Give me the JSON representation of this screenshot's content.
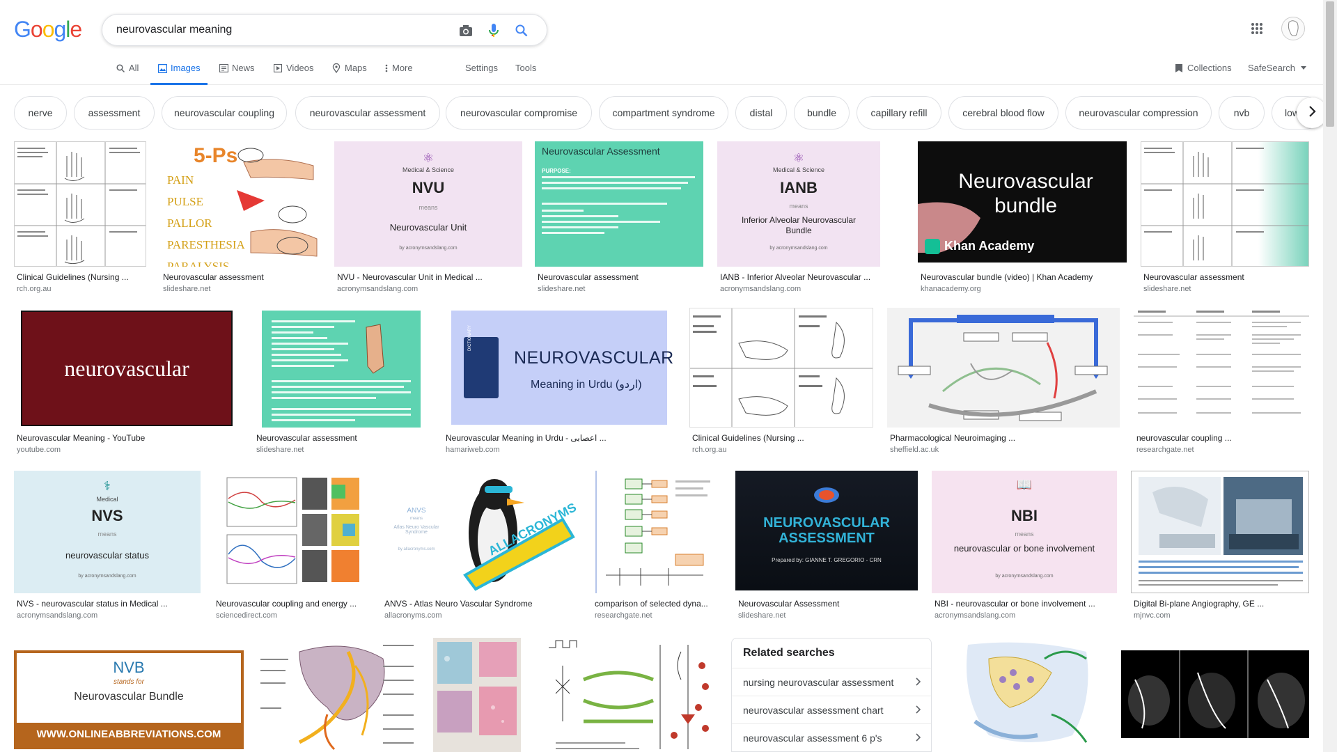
{
  "header": {
    "logo": [
      "G",
      "o",
      "o",
      "g",
      "l",
      "e"
    ],
    "query": "neurovascular meaning"
  },
  "tabs": [
    {
      "label": "All",
      "icon": "search-icon"
    },
    {
      "label": "Images",
      "icon": "image-icon"
    },
    {
      "label": "News",
      "icon": "news-icon"
    },
    {
      "label": "Videos",
      "icon": "video-icon"
    },
    {
      "label": "Maps",
      "icon": "map-pin-icon"
    },
    {
      "label": "More",
      "icon": "more-vert-icon"
    }
  ],
  "tools": {
    "settings": "Settings",
    "tools": "Tools",
    "collections": "Collections",
    "safesearch": "SafeSearch"
  },
  "chips": [
    "nerve",
    "assessment",
    "neurovascular coupling",
    "neurovascular assessment",
    "neurovascular compromise",
    "compartment syndrome",
    "distal",
    "bundle",
    "capillary refill",
    "cerebral blood flow",
    "neurovascular compression",
    "nvb",
    "low"
  ],
  "results": [
    {
      "title": "Clinical Guidelines (Nursing ...",
      "source": "rch.org.au"
    },
    {
      "title": "Neurovascular assessment",
      "source": "slideshare.net"
    },
    {
      "title": "NVU - Neurovascular Unit in Medical ...",
      "source": "acronymsandslang.com"
    },
    {
      "title": "Neurovascular assessment",
      "source": "slideshare.net"
    },
    {
      "title": "IANB - Inferior Alveolar Neurovascular ...",
      "source": "acronymsandslang.com"
    },
    {
      "title": "Neurovascular bundle (video) | Khan Academy",
      "source": "khanacademy.org"
    },
    {
      "title": "Neurovascular assessment",
      "source": "slideshare.net"
    },
    {
      "title": "Neurovascular Meaning - YouTube",
      "source": "youtube.com"
    },
    {
      "title": "Neurovascular assessment",
      "source": "slideshare.net"
    },
    {
      "title": "Neurovascular Meaning in Urdu - اعصابی ...",
      "source": "hamariweb.com"
    },
    {
      "title": "Clinical Guidelines (Nursing ...",
      "source": "rch.org.au"
    },
    {
      "title": "Pharmacological Neuroimaging ...",
      "source": "sheffield.ac.uk"
    },
    {
      "title": "neurovascular coupling ...",
      "source": "researchgate.net"
    },
    {
      "title": "NVS - neurovascular status in Medical ...",
      "source": "acronymsandslang.com"
    },
    {
      "title": "Neurovascular coupling and energy ...",
      "source": "sciencedirect.com"
    },
    {
      "title": "ANVS - Atlas Neuro Vascular Syndrome",
      "source": "allacronyms.com"
    },
    {
      "title": "comparison of selected dyna...",
      "source": "researchgate.net"
    },
    {
      "title": "Neurovascular Assessment",
      "source": "slideshare.net"
    },
    {
      "title": "NBI - neurovascular or bone involvement ...",
      "source": "acronymsandslang.com"
    },
    {
      "title": "Digital Bi-plane Angiography, GE ...",
      "source": "mjnvc.com"
    }
  ],
  "thumb_text": {
    "nvu_top": "Medical & Science",
    "nvu_abbr": "NVU",
    "nvu_means": "means",
    "nvu_full": "Neurovascular Unit",
    "nvu_by": "by acronymsandslang.com",
    "na_title": "Neurovascular Assessment",
    "na_purpose": "PURPOSE:",
    "ianb_top": "Medical & Science",
    "ianb_abbr": "IANB",
    "ianb_means": "means",
    "ianb_full": "Inferior Alveolar Neurovascular Bundle",
    "ianb_by": "by acronymsandslang.com",
    "khan_title": "Neurovascular bundle",
    "khan_brand": "Khan Academy",
    "five_p": "5-Ps",
    "p_words": [
      "PAIN",
      "PULSE",
      "PALLOR",
      "PARESTHESIA",
      "PARALYSIS"
    ],
    "yt_word": "neurovascular",
    "urdu_word": "NEUROVASCULAR",
    "urdu_sub": "Meaning in Urdu (اردو)",
    "dict": "DICTIONARY",
    "nvs_top": "Medical",
    "nvs_abbr": "NVS",
    "nvs_means": "means",
    "nvs_full": "neurovascular status",
    "nvs_by": "by acronymsandslang.com",
    "anvs_abbr": "ANVS",
    "anvs_means": "means",
    "anvs_full": "Atlas Neuro Vascular Syndrome",
    "anvs_by": "by allacronyms.com",
    "allacr": "ALLACRONYMS",
    "nass_title": "NEUROVASCULAR ASSESSMENT",
    "nass_by": "Prepared by: GIANNE T. GREGORIO - CRN",
    "nbi_abbr": "NBI",
    "nbi_means": "means",
    "nbi_full": "neurovascular or bone involvement",
    "nbi_by": "by acronymsandslang.com",
    "nvb_abbr": "NVB",
    "nvb_stands": "stands for",
    "nvb_full": "Neurovascular Bundle",
    "nvb_url": "WWW.ONLINEABBREVIATIONS.COM"
  },
  "related": {
    "title": "Related searches",
    "items": [
      "nursing neurovascular assessment",
      "neurovascular assessment chart",
      "neurovascular assessment 6 p's"
    ]
  },
  "colors": {
    "accent": "#1a73e8",
    "khan_green": "#14bf96",
    "yt_red": "#6e1119"
  }
}
